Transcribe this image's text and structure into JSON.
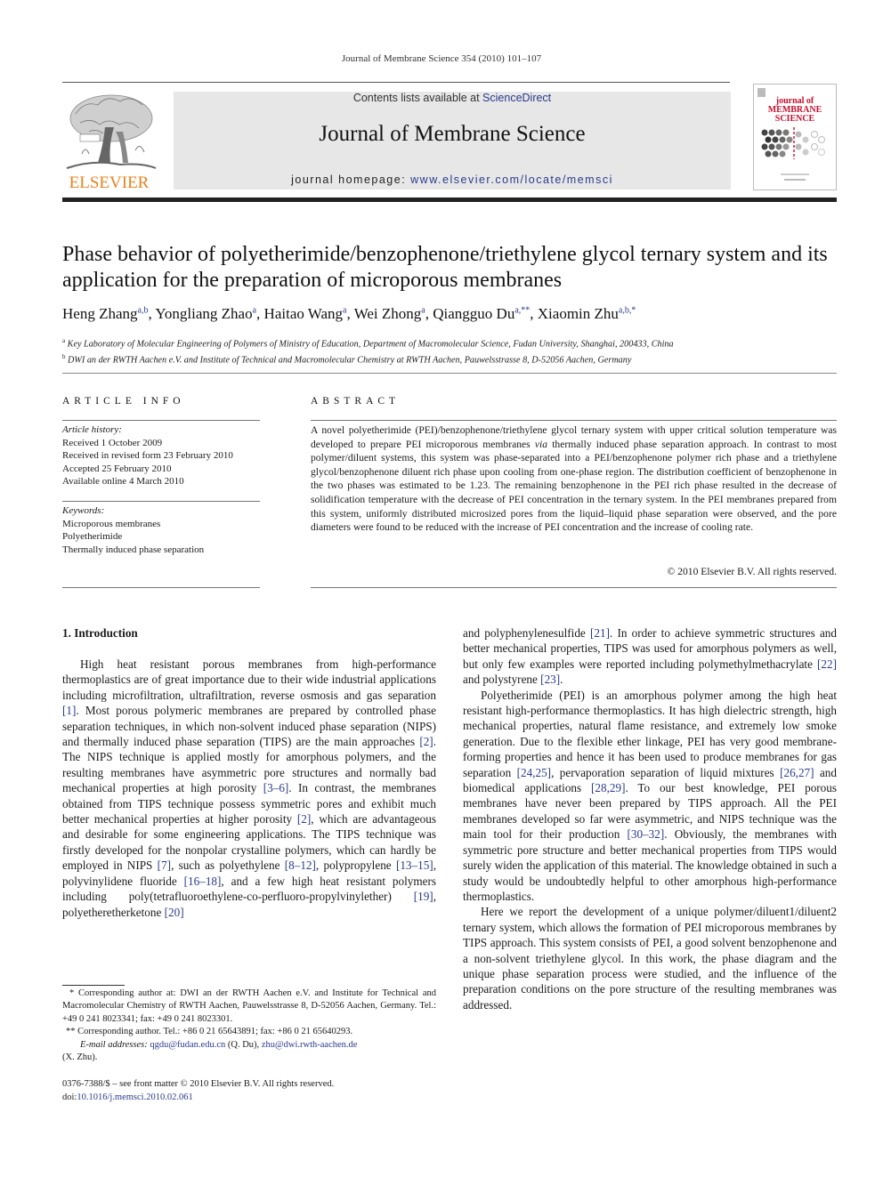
{
  "running_head": "Journal of Membrane Science 354 (2010) 101–107",
  "banner": {
    "contents_prefix": "Contents lists available at ",
    "contents_link": "ScienceDirect",
    "journal_name": "Journal of Membrane Science",
    "homepage_prefix": "journal homepage: ",
    "homepage_link": "www.elsevier.com/locate/memsci"
  },
  "publisher_logo": {
    "word": "ELSEVIER",
    "icon": "tree-logo-icon"
  },
  "cover": {
    "line1": "journal of",
    "line2": "MEMBRANE",
    "line3": "SCIENCE",
    "icon": "journal-cover-icon"
  },
  "colors": {
    "link": "#2a3a8c",
    "elsevier_orange": "#e8821e",
    "cover_red": "#c8102e",
    "banner_bg": "#e7e7e7"
  },
  "article": {
    "title": "Phase behavior of polyetherimide/benzophenone/triethylene glycol ternary system and its application for the preparation of microporous membranes",
    "authors": [
      {
        "name": "Heng Zhang",
        "sup": "a,b",
        "sep": ", "
      },
      {
        "name": "Yongliang Zhao",
        "sup": "a",
        "sep": ", "
      },
      {
        "name": "Haitao Wang",
        "sup": "a",
        "sep": ", "
      },
      {
        "name": "Wei Zhong",
        "sup": "a",
        "sep": ", "
      },
      {
        "name": "Qiangguo Du",
        "sup": "a,**",
        "sep": ", "
      },
      {
        "name": "Xiaomin Zhu",
        "sup": "a,b,*",
        "sep": ""
      }
    ],
    "affiliations": [
      {
        "mark": "a",
        "text": "Key Laboratory of Molecular Engineering of Polymers of Ministry of Education, Department of Macromolecular Science, Fudan University, Shanghai, 200433, China"
      },
      {
        "mark": "b",
        "text": "DWI an der RWTH Aachen e.V. and Institute of Technical and Macromolecular Chemistry at RWTH Aachen, Pauwelsstrasse 8, D-52056 Aachen, Germany"
      }
    ]
  },
  "article_info": {
    "heading": "ARTICLE INFO",
    "history_label": "Article history:",
    "history": [
      "Received 1 October 2009",
      "Received in revised form 23 February 2010",
      "Accepted 25 February 2010",
      "Available online 4 March 2010"
    ],
    "keywords_label": "Keywords:",
    "keywords": [
      "Microporous membranes",
      "Polyetherimide",
      "Thermally induced phase separation"
    ]
  },
  "abstract": {
    "heading": "ABSTRACT",
    "text_before_via": "A novel polyetherimide (PEI)/benzophenone/triethylene glycol ternary system with upper critical solution temperature was developed to prepare PEI microporous membranes ",
    "via": "via",
    "text_after_via": " thermally induced phase separation approach. In contrast to most polymer/diluent systems, this system was phase-separated into a PEI/benzophenone polymer rich phase and a triethylene glycol/benzophenone diluent rich phase upon cooling from one-phase region. The distribution coefficient of benzophenone in the two phases was estimated to be 1.23. The remaining benzophenone in the PEI rich phase resulted in the decrease of solidification temperature with the decrease of PEI concentration in the ternary system. In the PEI membranes prepared from this system, uniformly distributed microsized pores from the liquid–liquid phase separation were observed, and the pore diameters were found to be reduced with the increase of PEI concentration and the increase of cooling rate.",
    "copyright": "© 2010 Elsevier B.V. All rights reserved."
  },
  "introduction": {
    "heading": "1.  Introduction",
    "paragraphs": [
      {
        "indent": true,
        "segments": [
          {
            "t": "High heat resistant porous membranes from high-performance thermoplastics are of great importance due to their wide industrial applications including microfiltration, ultrafiltration, reverse osmosis and gas separation "
          },
          {
            "c": "[1]"
          },
          {
            "t": ". Most porous polymeric membranes are prepared by controlled phase separation techniques, in which non-solvent induced phase separation (NIPS) and thermally induced phase separation (TIPS) are the main approaches "
          },
          {
            "c": "[2]"
          },
          {
            "t": ". The NIPS technique is applied mostly for amorphous polymers, and the resulting membranes have asymmetric pore structures and normally bad mechanical properties at high porosity "
          },
          {
            "c": "[3–6]"
          },
          {
            "t": ". In contrast, the membranes obtained from TIPS technique possess symmetric pores and exhibit much better mechanical properties at higher porosity "
          },
          {
            "c": "[2]"
          },
          {
            "t": ", which are advantageous and desirable for some engineering applications. The TIPS technique was firstly developed for the nonpolar crystalline polymers, which can hardly be employed in NIPS "
          },
          {
            "c": "[7]"
          },
          {
            "t": ", such as polyethylene "
          },
          {
            "c": "[8–12]"
          },
          {
            "t": ", polypropylene "
          },
          {
            "c": "[13–15]"
          },
          {
            "t": ", polyvinylidene fluoride "
          },
          {
            "c": "[16–18]"
          },
          {
            "t": ", and a few high heat resistant polymers including poly(tetrafluoroethylene-co-perfluoro-propylvinylether) "
          },
          {
            "c": "[19]"
          },
          {
            "t": ", polyetheretherketone "
          },
          {
            "c": "[20]"
          }
        ]
      }
    ],
    "right_paragraphs": [
      {
        "indent": false,
        "segments": [
          {
            "t": "and polyphenylenesulfide "
          },
          {
            "c": "[21]"
          },
          {
            "t": ". In order to achieve symmetric structures and better mechanical properties, TIPS was used for amorphous polymers as well, but only few examples were reported including polymethylmethacrylate "
          },
          {
            "c": "[22]"
          },
          {
            "t": " and polystyrene "
          },
          {
            "c": "[23]"
          },
          {
            "t": "."
          }
        ]
      },
      {
        "indent": true,
        "segments": [
          {
            "t": "Polyetherimide (PEI) is an amorphous polymer among the high heat resistant high-performance thermoplastics. It has high dielectric strength, high mechanical properties, natural flame resistance, and extremely low smoke generation. Due to the flexible ether linkage, PEI has very good membrane-forming properties and hence it has been used to produce membranes for gas separation "
          },
          {
            "c": "[24,25]"
          },
          {
            "t": ", pervaporation separation of liquid mixtures "
          },
          {
            "c": "[26,27]"
          },
          {
            "t": " and biomedical applications "
          },
          {
            "c": "[28,29]"
          },
          {
            "t": ". To our best knowledge, PEI porous membranes have never been prepared by TIPS approach. All the PEI membranes developed so far were asymmetric, and NIPS technique was the main tool for their production "
          },
          {
            "c": "[30–32]"
          },
          {
            "t": ". Obviously, the membranes with symmetric pore structure and better mechanical properties from TIPS would surely widen the application of this material. The knowledge obtained in such a study would be undoubtedly helpful to other amorphous high-performance thermoplastics."
          }
        ]
      },
      {
        "indent": true,
        "segments": [
          {
            "t": "Here we report the development of a unique polymer/diluent1/diluent2 ternary system, which allows the formation of PEI microporous membranes by TIPS approach. This system consists of PEI, a good solvent benzophenone and a non-solvent triethylene glycol. In this work, the phase diagram and the unique phase separation process were studied, and the influence of the preparation conditions on the pore structure of the resulting membranes was addressed."
          }
        ]
      }
    ]
  },
  "footnotes": {
    "fn1": "* Corresponding author at: DWI an der RWTH Aachen e.V. and Institute for Technical and Macromolecular Chemistry of RWTH Aachen, Pauwelsstrasse 8, D-52056 Aachen, Germany. Tel.: +49 0 241 8023341; fax: +49 0 241 8023301.",
    "fn2": "** Corresponding author. Tel.: +86 0 21 65643891; fax: +86 0 21 65640293.",
    "email_label": "E-mail addresses:",
    "email1": "qgdu@fudan.edu.cn",
    "email1_owner": " (Q. Du), ",
    "email2": "zhu@dwi.rwth-aachen.de",
    "email2_owner": "(X. Zhu)."
  },
  "front_matter": {
    "issn_line": "0376-7388/$ – see front matter © 2010 Elsevier B.V. All rights reserved.",
    "doi_prefix": "doi:",
    "doi": "10.1016/j.memsci.2010.02.061"
  }
}
